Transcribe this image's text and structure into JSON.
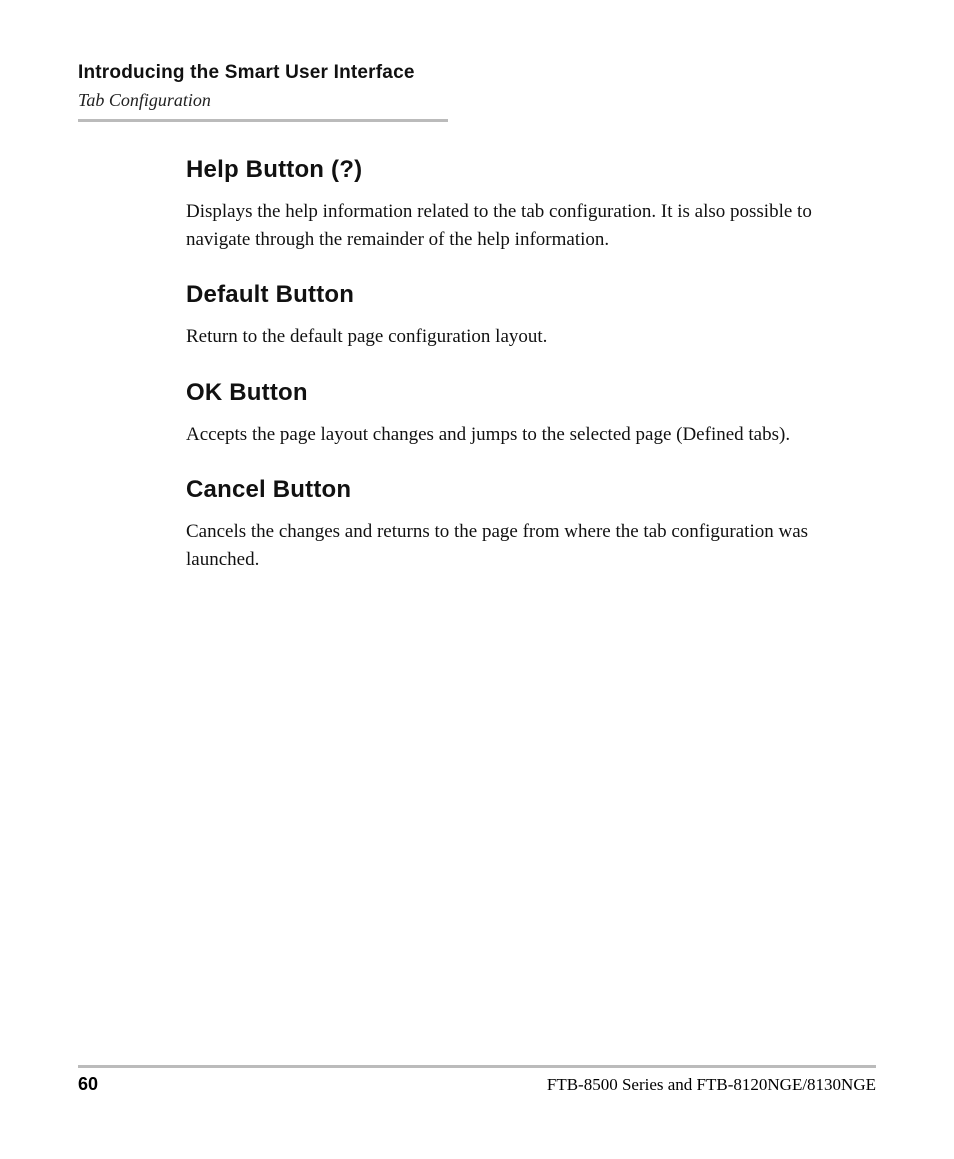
{
  "header": {
    "chapter": "Introducing the Smart User Interface",
    "subsection": "Tab Configuration"
  },
  "sections": [
    {
      "heading": "Help Button (?)",
      "body": "Displays the help information related to the tab configuration. It is also possible to navigate through the remainder of the help information."
    },
    {
      "heading": "Default Button",
      "body": "Return to the default page configuration layout."
    },
    {
      "heading": "OK Button",
      "body": "Accepts the page layout changes and jumps to the selected page (Defined tabs)."
    },
    {
      "heading": "Cancel Button",
      "body": "Cancels the changes and returns to the page from where the tab configuration was launched."
    }
  ],
  "footer": {
    "page_number": "60",
    "doc_title": "FTB-8500 Series and FTB-8120NGE/8130NGE"
  }
}
